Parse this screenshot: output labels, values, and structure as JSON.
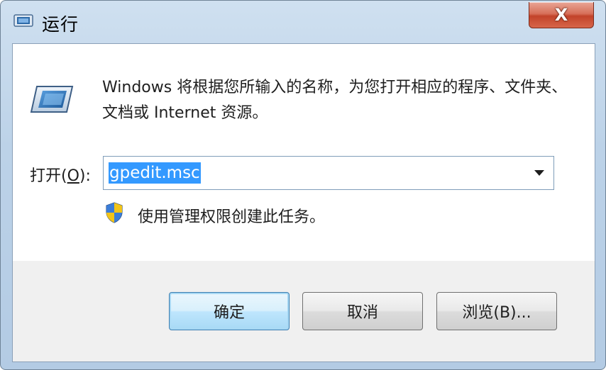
{
  "window": {
    "title": "运行",
    "close_glyph": "X"
  },
  "content": {
    "description": "Windows 将根据您所输入的名称，为您打开相应的程序、文件夹、文档或 Internet 资源。",
    "open_label_prefix": "打开(",
    "open_label_accel": "O",
    "open_label_suffix": "):",
    "open_value": "gpedit.msc",
    "uac_text": "使用管理权限创建此任务。"
  },
  "buttons": {
    "ok": "确定",
    "cancel": "取消",
    "browse": "浏览(B)..."
  },
  "icons": {
    "app": "run-icon",
    "big": "run-icon",
    "shield": "uac-shield-icon",
    "dropdown": "chevron-down-icon"
  },
  "colors": {
    "selection": "#3399ff",
    "default_button_border": "#3c7fb1",
    "close_button": "#c2432a"
  }
}
